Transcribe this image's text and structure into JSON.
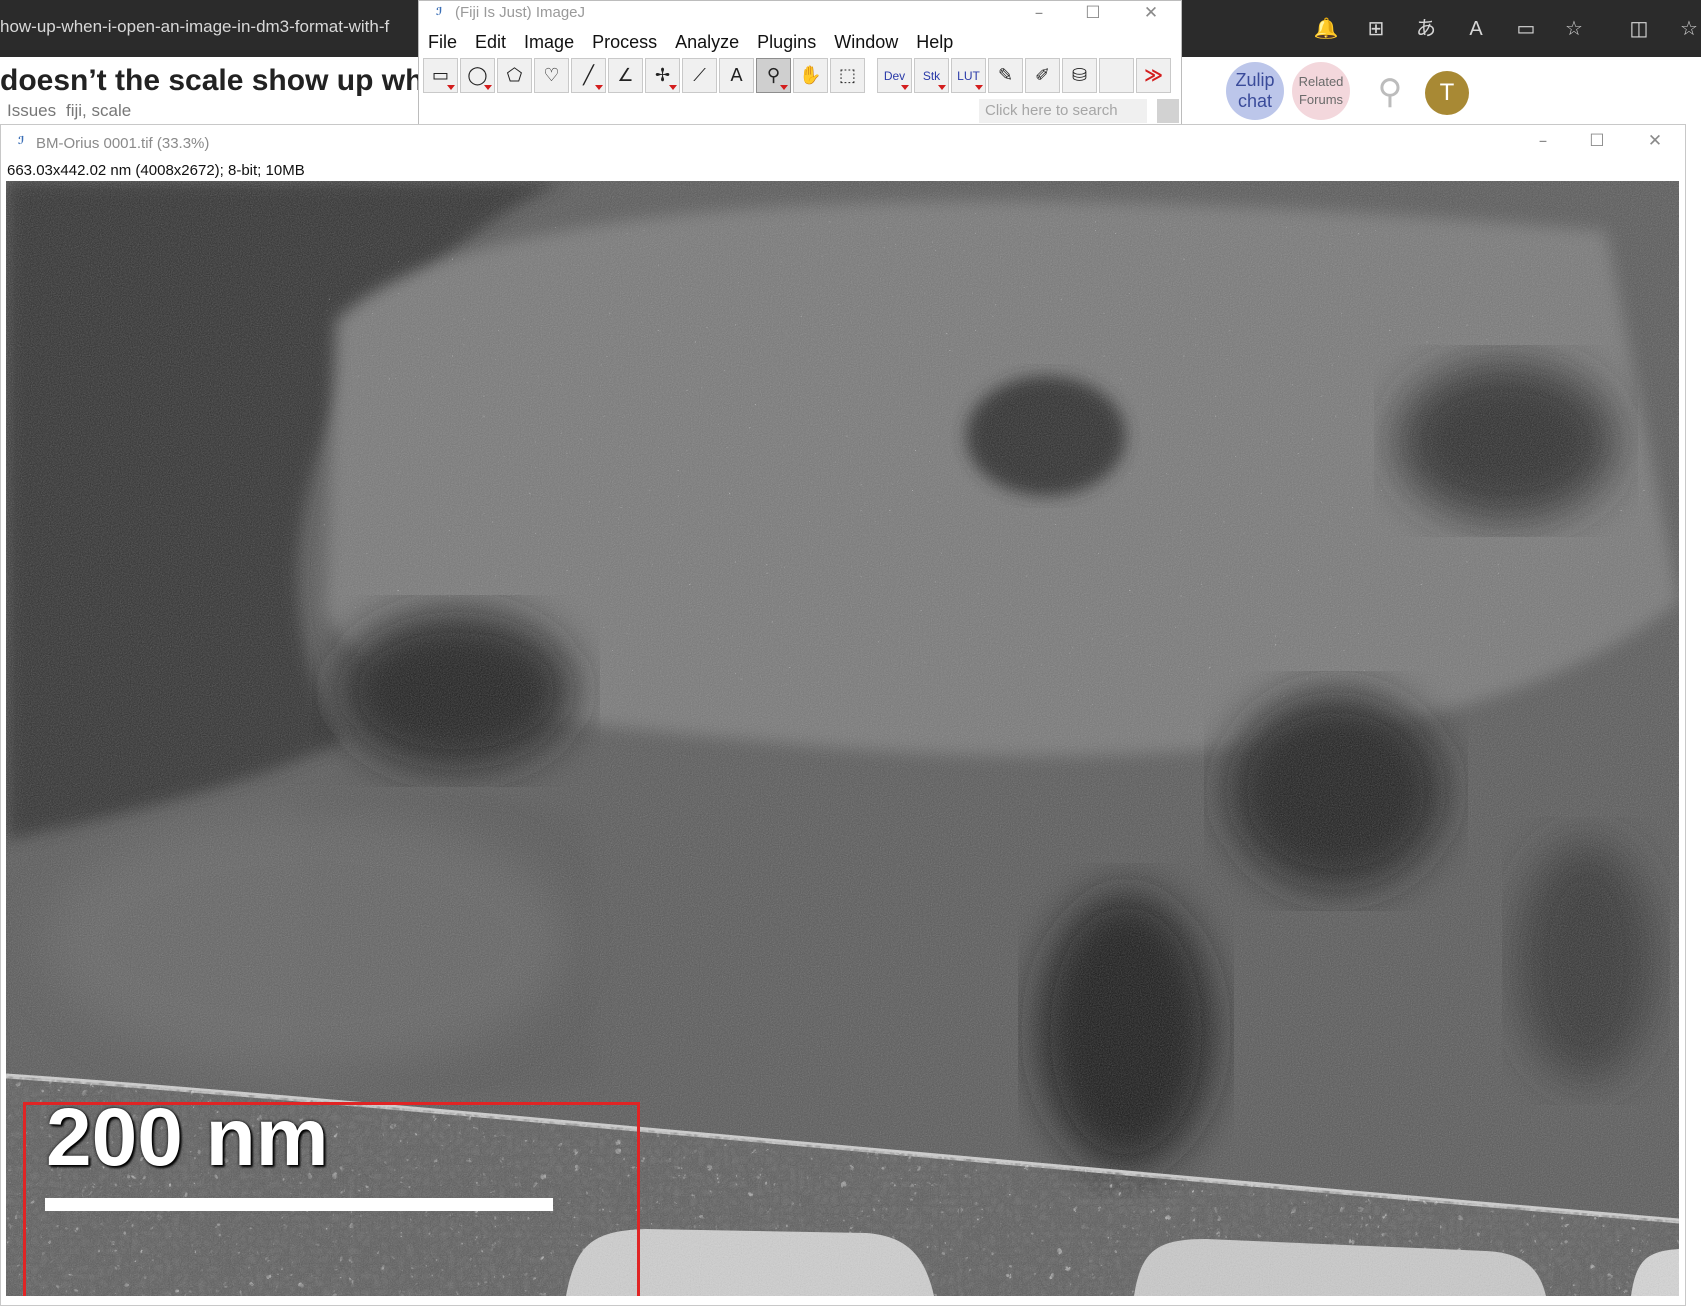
{
  "browser": {
    "url_fragment": "how-up-when-i-open-an-image-in-dm3-format-with-f",
    "icons": [
      "bell-icon",
      "extensions-icon",
      "translate-icon",
      "read-aloud-icon",
      "immersive-reader-icon",
      "favorite-star-icon",
      "split-screen-icon",
      "favorites-icon"
    ]
  },
  "forum": {
    "title_fragment": "doesn’t the scale show up wh",
    "category": "Issues",
    "tags": "fiji, scale",
    "zulip": {
      "line1": "Zulip",
      "line2": "chat"
    },
    "related": {
      "line1": "Related",
      "line2": "Forums"
    },
    "avatar_letter": "T"
  },
  "imagej": {
    "title": "(Fiji Is Just) ImageJ",
    "menus": [
      "File",
      "Edit",
      "Image",
      "Process",
      "Analyze",
      "Plugins",
      "Window",
      "Help"
    ],
    "tools": {
      "dev": "Dev",
      "stk": "Stk",
      "lut": "LUT"
    },
    "search_placeholder": "Click here to search"
  },
  "image_window": {
    "title": "BM-Orius 0001.tif (33.3%)",
    "info": "663.03x442.02 nm (4008x2672); 8-bit; 10MB",
    "scale_bar_label": "200 nm"
  },
  "colors": {
    "highlight": "#e02424",
    "tool_red": "#d31d1d",
    "avatar": "#a88934"
  }
}
